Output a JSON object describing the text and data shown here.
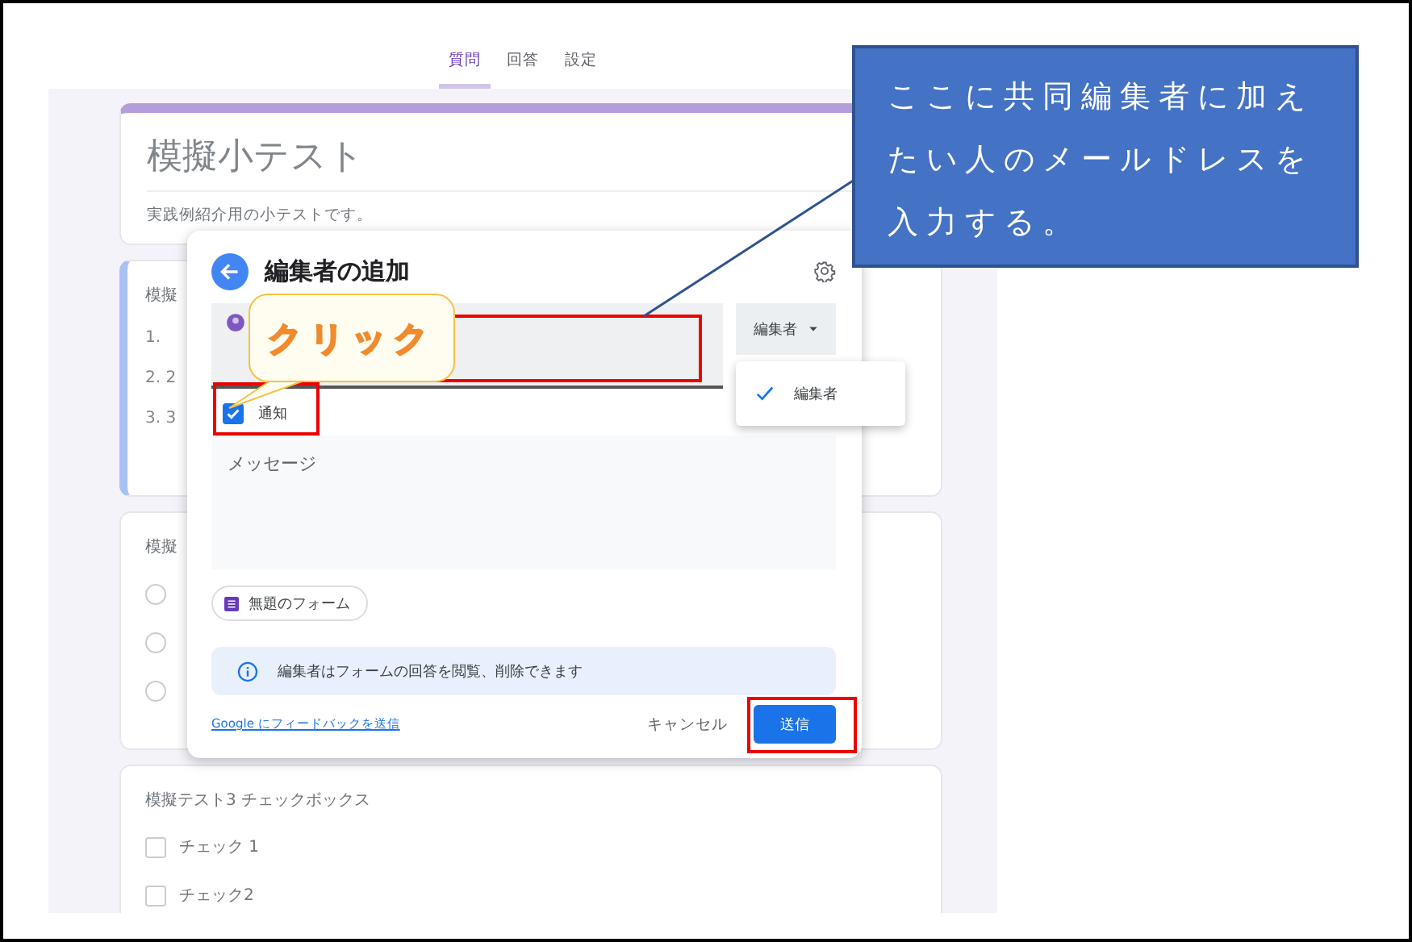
{
  "tabs": [
    {
      "label": "質問",
      "selected": true
    },
    {
      "label": "回答",
      "selected": false
    },
    {
      "label": "設定",
      "selected": false
    }
  ],
  "form": {
    "title": "模擬小テスト",
    "description": "実践例紹介用の小テストです。"
  },
  "questions": [
    {
      "kind": "list",
      "selected": true,
      "title": "模擬",
      "items": [
        "1.",
        "2.  2",
        "3.  3"
      ]
    },
    {
      "kind": "radio",
      "selected": false,
      "title": "模擬",
      "options": [
        {
          "checked": false
        },
        {
          "checked": false
        },
        {
          "checked": false
        }
      ]
    },
    {
      "kind": "checkbox",
      "selected": false,
      "title": "模擬テスト3 チェックボックス",
      "options": [
        {
          "label": "チェック 1",
          "checked": false
        },
        {
          "label": "チェック2",
          "checked": false
        }
      ]
    }
  ],
  "dialog": {
    "title": "編集者の追加",
    "role_button": "編集者",
    "role_menu": [
      {
        "label": "編集者",
        "selected": true
      }
    ],
    "notify": {
      "label": "通知",
      "checked": true
    },
    "message": {
      "placeholder": "メッセージ"
    },
    "form_chip": "無題のフォーム",
    "info": "編集者はフォームの回答を閲覧、削除できます",
    "feedback_link": "Google にフィードバックを送信",
    "cancel": "キャンセル",
    "send": "送信"
  },
  "annotations": {
    "click_callout": "クリック",
    "note_lines": [
      "ここに共同編集者に加え",
      "たい人のメールドレスを",
      "入力する。"
    ]
  }
}
